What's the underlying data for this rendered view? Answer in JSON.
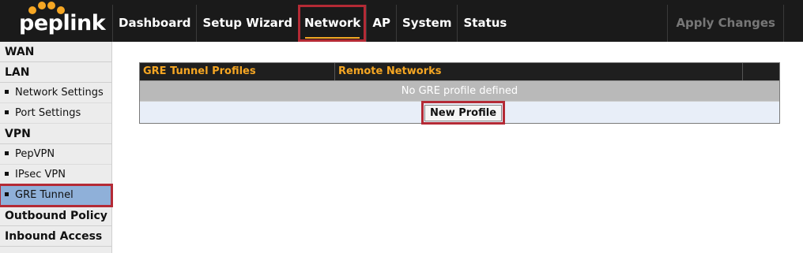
{
  "brand": {
    "logo_text": "peplink",
    "logo_color": "#f5a623"
  },
  "nav": {
    "items": [
      {
        "label": "Dashboard"
      },
      {
        "label": "Setup Wizard"
      },
      {
        "label": "Network",
        "active": true
      },
      {
        "label": "AP"
      },
      {
        "label": "System"
      },
      {
        "label": "Status"
      }
    ],
    "apply_label": "Apply Changes"
  },
  "sidebar": {
    "sections": [
      {
        "title": "WAN",
        "items": []
      },
      {
        "title": "LAN",
        "items": [
          {
            "label": "Network Settings"
          },
          {
            "label": "Port Settings"
          }
        ]
      },
      {
        "title": "VPN",
        "items": [
          {
            "label": "PepVPN"
          },
          {
            "label": "IPsec VPN"
          },
          {
            "label": "GRE Tunnel",
            "active": true
          }
        ]
      },
      {
        "title": "Outbound Policy",
        "items": []
      },
      {
        "title": "Inbound Access",
        "items": []
      }
    ]
  },
  "gre_table": {
    "columns": [
      "GRE Tunnel Profiles",
      "Remote Networks",
      ""
    ],
    "empty_message": "No GRE profile defined",
    "new_profile_label": "New Profile"
  },
  "colors": {
    "accent": "#f5a623",
    "highlight_border": "#b42a35",
    "active_sidebar": "#8fb0d9"
  }
}
